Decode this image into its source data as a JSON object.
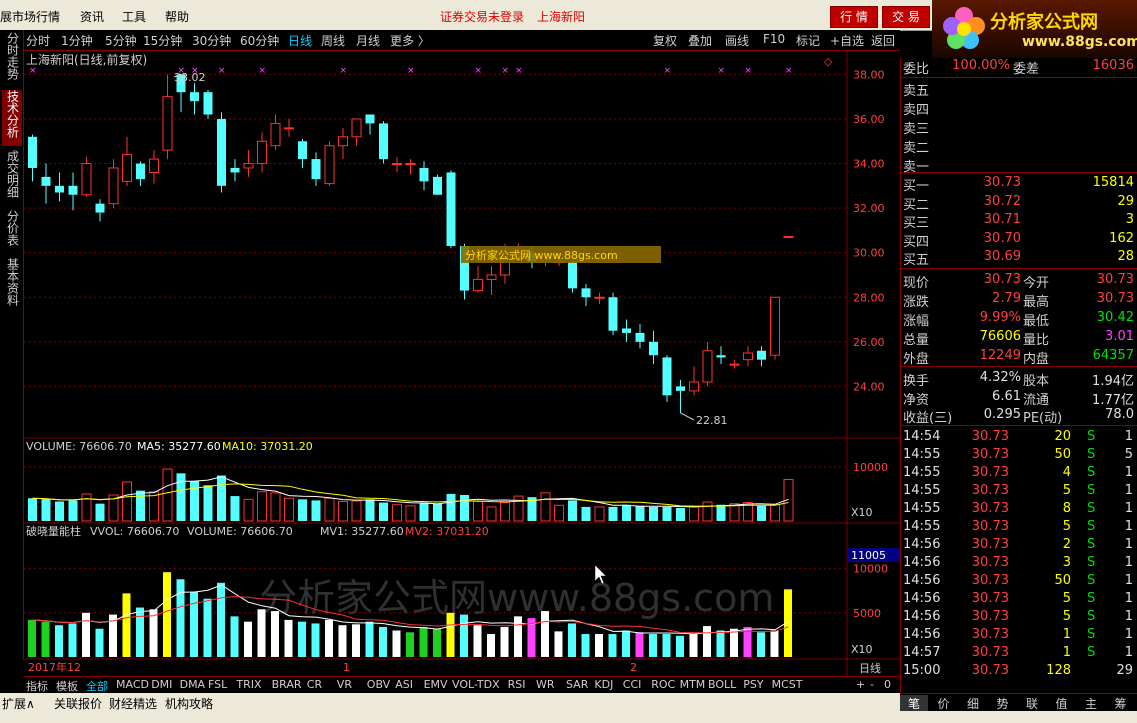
{
  "menu": {
    "items": [
      "展市场行情",
      "资讯",
      "工具",
      "帮助"
    ],
    "trade_status": "证券交易未登录",
    "stock_name": "上海新阳",
    "btn_quote": "行 情",
    "btn_trade": "交 易"
  },
  "logo": {
    "title": "分析家公式网",
    "url": "www.88gs.com",
    "hidden": "3.... "
  },
  "toolbar": {
    "periods": [
      "分时",
      "1分钟",
      "5分钟",
      "15分钟",
      "30分钟",
      "60分钟",
      "日线",
      "周线",
      "月线",
      "更多 〉"
    ],
    "active": "日线",
    "tools": [
      "复权",
      "叠加",
      "画线",
      "F10",
      "标记",
      "+自选",
      "返回"
    ]
  },
  "left_tabs": [
    "分时走势",
    "技术分析",
    "成交明细",
    "分价表",
    "基本资料"
  ],
  "chart": {
    "title": "上海新阳(日线,前复权)",
    "high_label": "38.02",
    "low_label": "22.81",
    "watermark_box": "分析家公式网 www.88gs.com",
    "volume_header": {
      "name": "VOLUME: 76606.70",
      "ma5": "MA5: 35277.60",
      "ma10": "MA10: 37031.20"
    },
    "indicator_header": {
      "name": "破晓量能柱",
      "vvol": "VVOL: 76606.70",
      "volume": "VOLUME: 76606.70",
      "mv1": "MV1: 35277.60",
      "mv2": "MV2: 37031.20"
    },
    "watermark_big": "分析家公式网www.88gs.com",
    "vol_unit": "X10",
    "ind_unit": "X10",
    "ind_highlight": "11005",
    "date_labels": [
      "2017年12",
      "1",
      "2"
    ],
    "period_label": "日线",
    "colors": {
      "up": "#ff3030",
      "down": "#54ffff",
      "grid": "#800000",
      "ma5": "#ffffff",
      "ma10": "#ffff00"
    }
  },
  "chart_data": {
    "type": "candlestick",
    "price_axis": {
      "ticks": [
        "38.00",
        "36.00",
        "34.00",
        "32.00",
        "30.00",
        "28.00",
        "26.00",
        "24.00"
      ],
      "range": [
        22.0,
        38.6
      ]
    },
    "volume_axis": {
      "ticks": [
        "10000"
      ]
    },
    "indicator_axis": {
      "ticks": [
        "10000",
        "5000"
      ]
    },
    "candles": [
      [
        35.2,
        33.8,
        35.3,
        33.2
      ],
      [
        33.4,
        33.0,
        34.0,
        32.2
      ],
      [
        33.0,
        32.7,
        33.6,
        32.3
      ],
      [
        33.0,
        32.6,
        33.6,
        31.9
      ],
      [
        32.6,
        34.0,
        34.3,
        32.5
      ],
      [
        32.2,
        31.8,
        32.4,
        31.4
      ],
      [
        32.2,
        33.8,
        34.2,
        32.0
      ],
      [
        33.2,
        34.4,
        35.2,
        33.0
      ],
      [
        34.0,
        33.3,
        34.1,
        33.0
      ],
      [
        33.6,
        34.2,
        34.6,
        33.1
      ],
      [
        34.6,
        37.0,
        38.0,
        34.2
      ],
      [
        38.0,
        37.2,
        38.02,
        36.3
      ],
      [
        37.2,
        36.8,
        37.6,
        36.2
      ],
      [
        37.2,
        36.2,
        37.3,
        36.0
      ],
      [
        36.0,
        33.0,
        36.3,
        32.7
      ],
      [
        33.8,
        33.6,
        34.2,
        33.2
      ],
      [
        33.8,
        34.0,
        34.6,
        33.4
      ],
      [
        34.0,
        35.0,
        35.4,
        33.6
      ],
      [
        34.8,
        35.8,
        36.2,
        34.6
      ],
      [
        35.6,
        35.6,
        36.0,
        35.2
      ],
      [
        35.0,
        34.2,
        35.1,
        33.8
      ],
      [
        34.2,
        33.3,
        34.5,
        33.0
      ],
      [
        33.1,
        34.8,
        35.0,
        33.0
      ],
      [
        34.8,
        35.2,
        35.6,
        34.2
      ],
      [
        35.2,
        36.0,
        36.0,
        34.8
      ],
      [
        36.2,
        35.8,
        36.2,
        35.3
      ],
      [
        35.8,
        34.2,
        35.9,
        34.0
      ],
      [
        34.0,
        34.0,
        34.3,
        33.6
      ],
      [
        34.0,
        34.0,
        34.2,
        33.5
      ],
      [
        33.8,
        33.2,
        34.1,
        32.8
      ],
      [
        33.4,
        32.6,
        33.5,
        32.6
      ],
      [
        33.6,
        30.3,
        33.7,
        30.2
      ],
      [
        30.3,
        28.3,
        30.4,
        27.9
      ],
      [
        28.3,
        28.8,
        29.4,
        28.2
      ],
      [
        28.8,
        29.0,
        29.4,
        28.1
      ],
      [
        29.0,
        29.8,
        30.4,
        28.6
      ],
      [
        29.8,
        29.9,
        30.4,
        29.6
      ],
      [
        30.0,
        29.6,
        30.3,
        29.3
      ],
      [
        29.6,
        29.7,
        30.2,
        29.4
      ],
      [
        29.6,
        29.6,
        30.0,
        29.4
      ],
      [
        29.6,
        28.4,
        29.7,
        28.2
      ],
      [
        28.4,
        28.0,
        28.6,
        27.6
      ],
      [
        28.0,
        28.0,
        28.2,
        27.7
      ],
      [
        28.0,
        26.5,
        28.2,
        26.3
      ],
      [
        26.6,
        26.4,
        27.0,
        26.0
      ],
      [
        26.4,
        26.0,
        26.8,
        25.7
      ],
      [
        26.0,
        25.4,
        26.5,
        25.0
      ],
      [
        25.3,
        23.6,
        25.4,
        23.3
      ],
      [
        24.0,
        23.8,
        24.3,
        22.81
      ],
      [
        23.8,
        24.2,
        24.9,
        23.6
      ],
      [
        24.2,
        25.6,
        26.0,
        24.0
      ],
      [
        25.4,
        25.3,
        25.8,
        25.0
      ],
      [
        25.0,
        25.0,
        25.2,
        24.8
      ],
      [
        25.2,
        25.5,
        25.8,
        24.9
      ],
      [
        25.6,
        25.2,
        25.8,
        24.9
      ],
      [
        25.4,
        28.0,
        28.0,
        25.2
      ],
      [
        30.73,
        30.73,
        30.73,
        30.73
      ]
    ],
    "volumes": [
      4200,
      4000,
      3600,
      3800,
      5000,
      3200,
      4800,
      7200,
      5600,
      5400,
      9600,
      8800,
      7400,
      6600,
      8400,
      4600,
      4000,
      5400,
      5200,
      4200,
      4000,
      3800,
      4200,
      3600,
      3700,
      4000,
      3400,
      3000,
      2800,
      3400,
      3200,
      5000,
      4800,
      3600,
      2600,
      3400,
      4600,
      4400,
      5200,
      2900,
      3800,
      2600,
      2600,
      2600,
      3000,
      2800,
      2600,
      2600,
      2400,
      2600,
      3500,
      3000,
      3200,
      3400,
      2800,
      3000,
      7660
    ],
    "date_axis": [
      "2017年12",
      "1",
      "2"
    ]
  },
  "quote": {
    "weibi_label": "委比",
    "weibi": "100.00%",
    "weicha_label": "委差",
    "weicha": "16036",
    "sells": [
      {
        "label": "卖五"
      },
      {
        "label": "卖四"
      },
      {
        "label": "卖三"
      },
      {
        "label": "卖二"
      },
      {
        "label": "卖一"
      }
    ],
    "buys": [
      {
        "label": "买一",
        "price": "30.73",
        "vol": "15814"
      },
      {
        "label": "买二",
        "price": "30.72",
        "vol": "29"
      },
      {
        "label": "买三",
        "price": "30.71",
        "vol": "3"
      },
      {
        "label": "买四",
        "price": "30.70",
        "vol": "162"
      },
      {
        "label": "买五",
        "price": "30.69",
        "vol": "28"
      }
    ],
    "stats": [
      {
        "a": "现价",
        "b": "30.73",
        "c": "今开",
        "d": "30.73"
      },
      {
        "a": "涨跌",
        "b": "2.79",
        "c": "最高",
        "d": "30.73"
      },
      {
        "a": "涨幅",
        "b": "9.99%",
        "c": "最低",
        "d": "30.42"
      },
      {
        "a": "总量",
        "b": "76606",
        "c": "量比",
        "d": "3.01"
      },
      {
        "a": "外盘",
        "b": "12249",
        "c": "内盘",
        "d": "64357"
      }
    ],
    "fund": [
      {
        "a": "换手",
        "b": "4.32%",
        "c": "股本",
        "d": "1.94亿"
      },
      {
        "a": "净资",
        "b": "6.61",
        "c": "流通",
        "d": "1.77亿"
      },
      {
        "a": "收益(三)",
        "b": "0.295",
        "c": "PE(动)",
        "d": "78.0"
      }
    ],
    "ticks": [
      {
        "t": "14:54",
        "p": "30.73",
        "v": "20",
        "s": "S",
        "n": "1"
      },
      {
        "t": "14:55",
        "p": "30.73",
        "v": "50",
        "s": "S",
        "n": "5"
      },
      {
        "t": "14:55",
        "p": "30.73",
        "v": "4",
        "s": "S",
        "n": "1"
      },
      {
        "t": "14:55",
        "p": "30.73",
        "v": "5",
        "s": "S",
        "n": "1"
      },
      {
        "t": "14:55",
        "p": "30.73",
        "v": "8",
        "s": "S",
        "n": "1"
      },
      {
        "t": "14:55",
        "p": "30.73",
        "v": "5",
        "s": "S",
        "n": "1"
      },
      {
        "t": "14:56",
        "p": "30.73",
        "v": "2",
        "s": "S",
        "n": "1"
      },
      {
        "t": "14:56",
        "p": "30.73",
        "v": "3",
        "s": "S",
        "n": "1"
      },
      {
        "t": "14:56",
        "p": "30.73",
        "v": "50",
        "s": "S",
        "n": "1"
      },
      {
        "t": "14:56",
        "p": "30.73",
        "v": "5",
        "s": "S",
        "n": "1"
      },
      {
        "t": "14:56",
        "p": "30.73",
        "v": "5",
        "s": "S",
        "n": "1"
      },
      {
        "t": "14:56",
        "p": "30.73",
        "v": "1",
        "s": "S",
        "n": "1"
      },
      {
        "t": "14:57",
        "p": "30.73",
        "v": "1",
        "s": "S",
        "n": "1"
      },
      {
        "t": "15:00",
        "p": "30.73",
        "v": "128",
        "s": "",
        "n": "29"
      }
    ]
  },
  "indicator_tabs": [
    "指标",
    "模板",
    "全部",
    "MACD",
    "DMI",
    "DMA",
    "FSL",
    "TRIX",
    "BRAR",
    "CR",
    "VR",
    "OBV",
    "ASI",
    "EMV",
    "VOL-TDX",
    "RSI",
    "WR",
    "SAR",
    "KDJ",
    "CCI",
    "ROC",
    "MTM",
    "BOLL",
    "PSY",
    "MCST"
  ],
  "indicator_tab_active": "全部",
  "tab_controls": [
    "+",
    "-",
    "0"
  ],
  "bottom_bar": [
    "扩展∧",
    "关联报价",
    "财经精选",
    "机构攻略"
  ],
  "right_bottom_tabs": [
    "笔",
    "价",
    "细",
    "势",
    "联",
    "值",
    "主",
    "筹"
  ],
  "right_bottom_active": "笔"
}
